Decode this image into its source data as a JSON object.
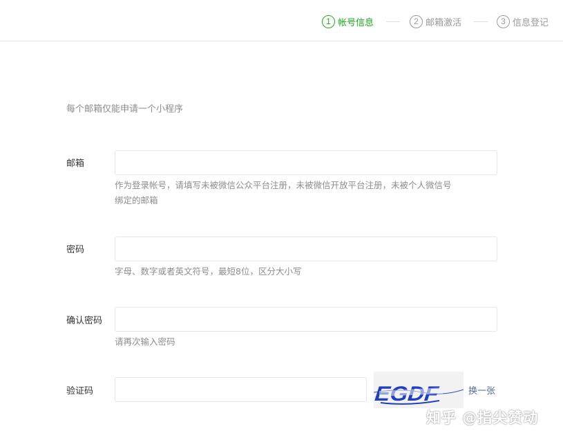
{
  "steps": [
    {
      "num": "1",
      "label": "帐号信息"
    },
    {
      "num": "2",
      "label": "邮箱激活"
    },
    {
      "num": "3",
      "label": "信息登记"
    }
  ],
  "active_color": "#1aad19",
  "tip": "每个邮箱仅能申请一个小程序",
  "email": {
    "label": "邮箱",
    "value": "",
    "hint_line1": "作为登录帐号，请填写未被微信公众平台注册，未被微信开放平台注册，未被个人微信号",
    "hint_line2": "绑定的邮箱"
  },
  "password": {
    "label": "密码",
    "value": "",
    "hint": "字母、数字或者英文符号，最短8位，区分大小写"
  },
  "confirm_password": {
    "label": "确认密码",
    "value": "",
    "hint": "请再次输入密码"
  },
  "captcha": {
    "label": "验证码",
    "value": "",
    "image_text": "EGDF",
    "refresh_label": "换一张"
  },
  "watermark": "知乎 @指尖赞动"
}
